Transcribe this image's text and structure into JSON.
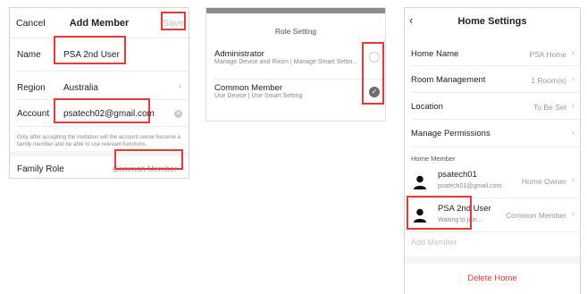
{
  "add_member": {
    "cancel_label": "Cancel",
    "title": "Add Member",
    "save_label": "Save",
    "name_label": "Name",
    "name_value": "PSA 2nd User",
    "region_label": "Region",
    "region_value": "Australia",
    "account_label": "Account",
    "account_value": "psatech02@gmail.com",
    "hint": "Only after accepting the invitation will the account owner become a family member and be able to use relevant functions.",
    "family_role_label": "Family Role",
    "family_role_value": "Common Member"
  },
  "role_setting": {
    "title": "Role Setting",
    "options": [
      {
        "title": "Administrator",
        "subtitle": "Manage Device and Room | Manage Smart Settin...",
        "selected": false
      },
      {
        "title": "Common Member",
        "subtitle": "Use Device | Use Smart Setting",
        "selected": true
      }
    ]
  },
  "home_settings": {
    "title": "Home Settings",
    "rows": [
      {
        "label": "Home Name",
        "value": "PSA Home"
      },
      {
        "label": "Room Management",
        "value": "1 Room(s)"
      },
      {
        "label": "Location",
        "value": "To Be Set"
      },
      {
        "label": "Manage Permissions",
        "value": ""
      }
    ],
    "section_label": "Home Member",
    "members": [
      {
        "name": "psatech01",
        "sub": "psatech01@gmail.com",
        "role": "Home Owner"
      },
      {
        "name": "PSA 2nd User",
        "sub": "Waiting to join...",
        "role": "Common Member"
      }
    ],
    "add_member_label": "Add Member",
    "delete_label": "Delete Home"
  },
  "icons": {
    "back": "chevron-left-icon",
    "chevron": "chevron-right-icon",
    "clear": "clear-icon",
    "check": "check-icon",
    "person": "person-icon"
  },
  "colors": {
    "highlight": "#e53a3a",
    "delete": "#e0403a",
    "selected_radio": "#6e6e6e"
  }
}
